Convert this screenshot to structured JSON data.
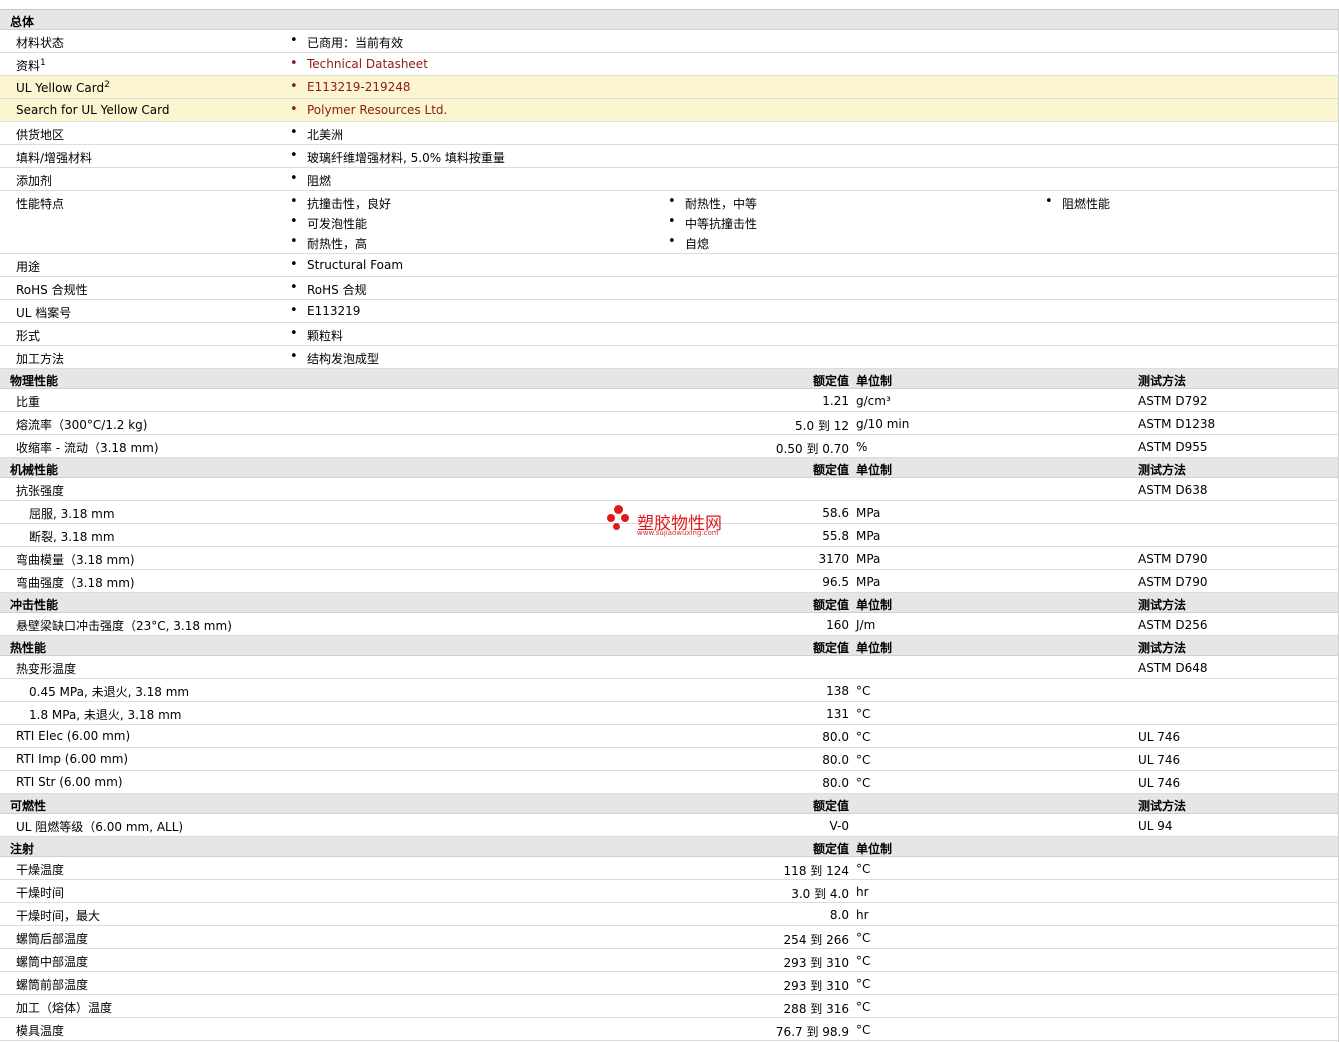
{
  "general": {
    "title": "总体",
    "rows": [
      {
        "label": "材料状态",
        "values": [
          "已商用：当前有效"
        ]
      },
      {
        "label": "资料",
        "sup": "1",
        "values": [
          "Technical Datasheet"
        ],
        "link": true
      },
      {
        "label": "UL Yellow Card",
        "sup": "2",
        "values": [
          "E113219-219248"
        ],
        "link": true,
        "highlight": true
      },
      {
        "label": "Search for UL Yellow Card",
        "values": [
          "Polymer Resources Ltd."
        ],
        "link": true,
        "highlight": true
      },
      {
        "label": "供货地区",
        "values": [
          "北美洲"
        ]
      },
      {
        "label": "填料/增强材料",
        "values": [
          "玻璃纤维增强材料, 5.0% 填料按重量"
        ]
      },
      {
        "label": "添加剂",
        "values": [
          "阻燃"
        ]
      },
      {
        "label": "性能特点",
        "columns": [
          [
            "抗撞击性，良好",
            "可发泡性能",
            "耐热性，高"
          ],
          [
            "耐热性，中等",
            "中等抗撞击性",
            "自熄"
          ],
          [
            "阻燃性能"
          ]
        ]
      },
      {
        "label": "用途",
        "values": [
          "Structural Foam"
        ]
      },
      {
        "label": "RoHS 合规性",
        "values": [
          "RoHS 合规"
        ]
      },
      {
        "label": "UL 档案号",
        "values": [
          "E113219"
        ]
      },
      {
        "label": "形式",
        "values": [
          "颗粒料"
        ]
      },
      {
        "label": "加工方法",
        "values": [
          "结构发泡成型"
        ]
      }
    ]
  },
  "headers": {
    "rated": "额定值",
    "unit": "单位制",
    "test": "测试方法"
  },
  "sections": [
    {
      "title": "物理性能",
      "show_unit": true,
      "show_test": true,
      "rows": [
        {
          "label": "比重",
          "value": "1.21",
          "unit": "g/cm³",
          "test": "ASTM D792"
        },
        {
          "label": "熔流率（300°C/1.2 kg)",
          "value": "5.0 到  12",
          "unit": "g/10 min",
          "test": "ASTM D1238"
        },
        {
          "label": "收缩率  - 流动（3.18 mm)",
          "value": "0.50 到  0.70",
          "unit": "%",
          "test": "ASTM D955"
        }
      ]
    },
    {
      "title": "机械性能",
      "show_unit": true,
      "show_test": true,
      "rows": [
        {
          "label": "抗张强度",
          "value": "",
          "unit": "",
          "test": "ASTM D638"
        },
        {
          "label": "屈服, 3.18 mm",
          "indent": true,
          "value": "58.6",
          "unit": "MPa",
          "test": ""
        },
        {
          "label": "断裂, 3.18 mm",
          "indent": true,
          "value": "55.8",
          "unit": "MPa",
          "test": ""
        },
        {
          "label": "弯曲模量（3.18 mm)",
          "value": "3170",
          "unit": "MPa",
          "test": "ASTM D790"
        },
        {
          "label": "弯曲强度（3.18 mm)",
          "value": "96.5",
          "unit": "MPa",
          "test": "ASTM D790"
        }
      ]
    },
    {
      "title": "冲击性能",
      "show_unit": true,
      "show_test": true,
      "rows": [
        {
          "label": "悬壁梁缺口冲击强度（23°C, 3.18 mm)",
          "value": "160",
          "unit": "J/m",
          "test": "ASTM D256"
        }
      ]
    },
    {
      "title": "热性能",
      "show_unit": true,
      "show_test": true,
      "rows": [
        {
          "label": "热变形温度",
          "value": "",
          "unit": "",
          "test": "ASTM D648"
        },
        {
          "label": "0.45 MPa, 未退火, 3.18 mm",
          "indent": true,
          "value": "138",
          "unit": "°C",
          "test": ""
        },
        {
          "label": "1.8 MPa, 未退火, 3.18 mm",
          "indent": true,
          "value": "131",
          "unit": "°C",
          "test": ""
        },
        {
          "label": "RTI Elec (6.00 mm)",
          "value": "80.0",
          "unit": "°C",
          "test": "UL 746"
        },
        {
          "label": "RTI Imp (6.00 mm)",
          "value": "80.0",
          "unit": "°C",
          "test": "UL 746"
        },
        {
          "label": "RTI Str (6.00 mm)",
          "value": "80.0",
          "unit": "°C",
          "test": "UL 746"
        }
      ]
    },
    {
      "title": "可燃性",
      "show_unit": false,
      "show_test": true,
      "rows": [
        {
          "label": "UL 阻燃等级（6.00 mm, ALL)",
          "value": "V-0",
          "unit": "",
          "test": "UL 94"
        }
      ]
    },
    {
      "title": "注射",
      "show_unit": true,
      "show_test": false,
      "rows": [
        {
          "label": "干燥温度",
          "value": "118 到  124",
          "unit": "°C",
          "test": ""
        },
        {
          "label": "干燥时间",
          "value": "3.0 到  4.0",
          "unit": "hr",
          "test": ""
        },
        {
          "label": "干燥时间，最大",
          "value": "8.0",
          "unit": "hr",
          "test": ""
        },
        {
          "label": "螺筒后部温度",
          "value": "254 到  266",
          "unit": "°C",
          "test": ""
        },
        {
          "label": "螺筒中部温度",
          "value": "293 到  310",
          "unit": "°C",
          "test": ""
        },
        {
          "label": "螺筒前部温度",
          "value": "293 到  310",
          "unit": "°C",
          "test": ""
        },
        {
          "label": "加工（熔体）温度",
          "value": "288 到  316",
          "unit": "°C",
          "test": ""
        },
        {
          "label": "模具温度",
          "value": "76.7 到  98.9",
          "unit": "°C",
          "test": ""
        }
      ]
    }
  ],
  "watermark": {
    "text": "塑胶物性网",
    "url": "www.sujiaowuxing.com"
  },
  "colors": {
    "link": "#8b1a1a",
    "highlight": "#fbf6d0",
    "section_bg": "#e6e6e6",
    "watermark": "#e01a1a"
  }
}
